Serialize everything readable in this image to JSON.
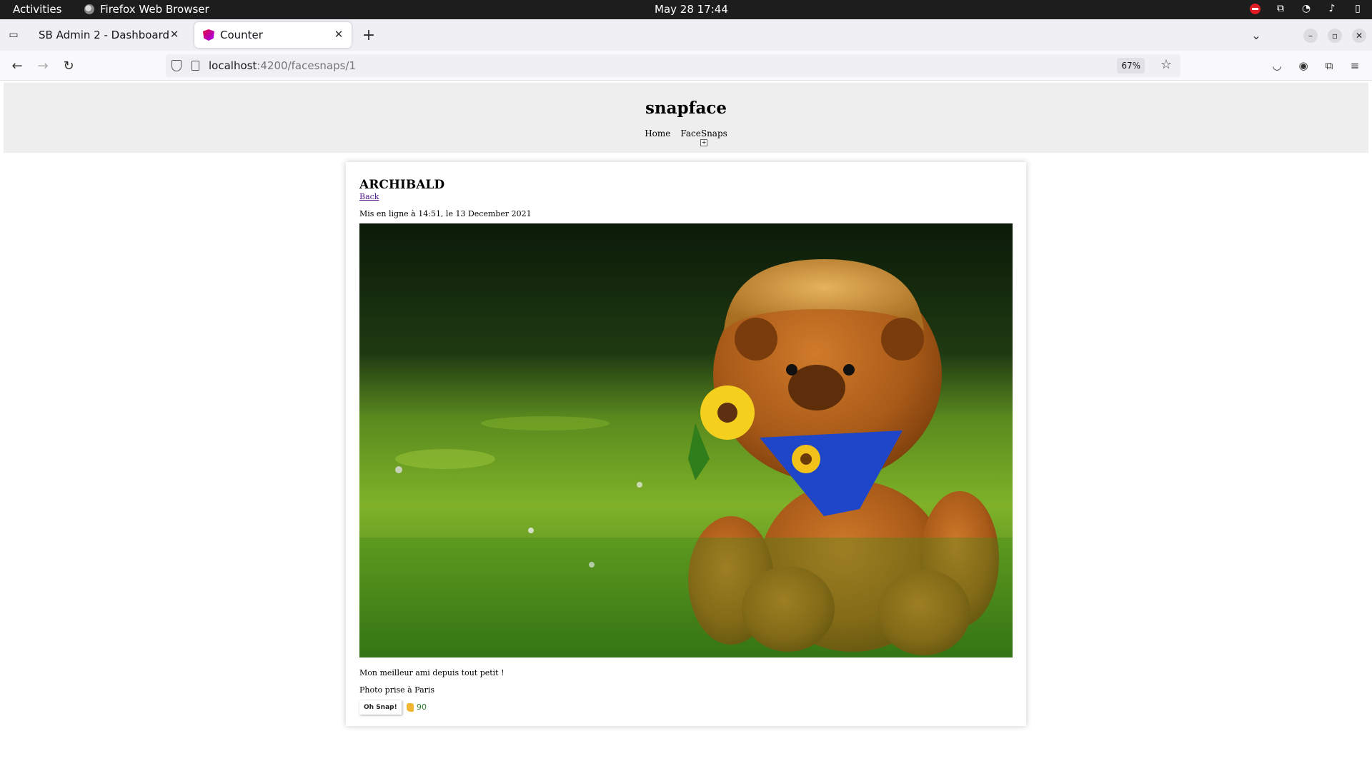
{
  "system_bar": {
    "activities": "Activities",
    "app_name": "Firefox Web Browser",
    "clock": "May 28  17:44"
  },
  "browser": {
    "tabs": [
      {
        "title": "SB Admin 2 - Dashboard",
        "active": false
      },
      {
        "title": "Counter",
        "active": true
      }
    ],
    "url_host": "localhost",
    "url_path": ":4200/facesnaps/1",
    "zoom": "67%"
  },
  "site": {
    "title": "snapface",
    "nav": {
      "home": "Home",
      "facesnaps": "FaceSnaps"
    }
  },
  "facesnap": {
    "title": "ARCHIBALD",
    "back_link": "Back",
    "date": "Mis en ligne à 14:51, le 13 December 2021",
    "description": "Mon meilleur ami depuis tout petit !",
    "location": "Photo prise à Paris",
    "button_label": "Oh Snap!",
    "snaps": "90"
  },
  "icons": [
    "tab-list-icon",
    "close-icon",
    "plus-icon",
    "chevron-down-icon",
    "minimize-icon",
    "maximize-icon",
    "back-arrow-icon",
    "forward-arrow-icon",
    "reload-icon",
    "shield-icon",
    "page-icon",
    "star-icon",
    "pocket-icon",
    "account-icon",
    "extensions-icon",
    "menu-icon",
    "thumbs-up-icon"
  ]
}
